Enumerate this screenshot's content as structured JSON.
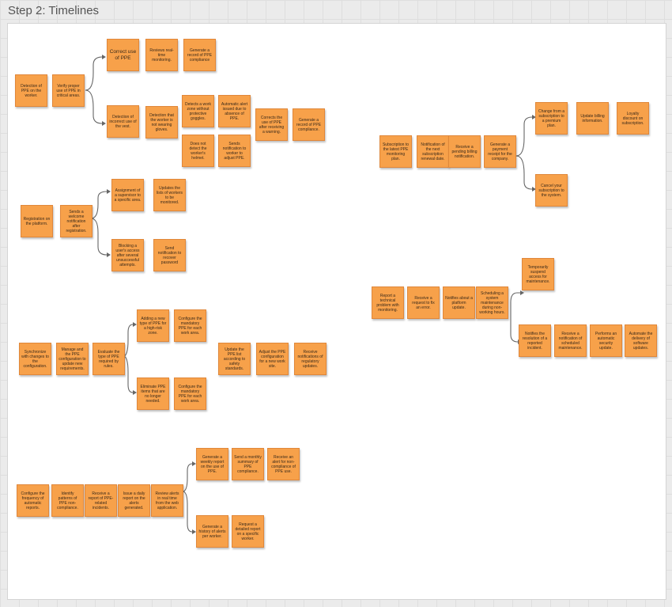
{
  "page": {
    "title": "Step 2: Timelines"
  },
  "notes": [
    "Detection of PPE on the worker.",
    "Verify proper use of PPE in critical areas.",
    "Correct use of PPE",
    "Reviews real-time monitoring.",
    "Generate a record of PPE compliance",
    "Detection of incorrect use of the vest.",
    "Detection that the worker is not wearing gloves.",
    "Detects a work zone without protective goggles.",
    "Automatic alert issued due to absence of PPE.",
    "Does not detect the worker's helmet.",
    "Sends notification to worker to adjust PPE.",
    "Corrects the use of PPE after receiving a warning.",
    "Generate a record of PPE compliance.",
    "Registration on the platform.",
    "Sends a welcome notification after registration.",
    "Assignment of a supervisor to a specific area.",
    "Updates the lists of workers to be monitored.",
    "Blocking a user's access after several unsuccessful attempts.",
    "Send notification to recover password",
    "Synchronize with changes to the configuration.",
    "Manage and the PPE configuration to update new requirements.",
    "Evaluate the type of PPE required by rules.",
    "Adding a new type of PPE for a high-risk zone.",
    "Configure the mandatory PPE for each work area.",
    "Eliminate PPE items that are no longer needed.",
    "Configure the mandatory PPE for each work area.",
    "Update the PPE list according to safety standards.",
    "Adjust the PPE configuration for a new work site.",
    "Receive notifications of regulatory updates.",
    "Configure the frequency of automatic reports.",
    "Identify patterns of PPE non-compliance.",
    "Receive a report of PPE-related incidents.",
    "Issue a daily report on the alerts generated.",
    "Review alerts in real time from the web application.",
    "Generate a weekly report on the use of PPE.",
    "Send a monthly summary of PPE compliance.",
    "Receive an alert for non-compliance of PPE use.",
    "Generate a history of alerts per worker.",
    "Request a detailed report on a specific worker.",
    "Subscription to the latest PPE monitoring plan.",
    "Notification of the next subscription renewal date.",
    "Receive a pending billing notification.",
    "Generate a payment receipt for the company.",
    "Change from a subscription to a premium plan.",
    "Update billing information.",
    "Loyalty discount on subscription.",
    "Cancel your subscription to the system.",
    "Report a technical problem with monitoring.",
    "Receive a request to fix an error.",
    "Notifies about a platform update.",
    "Scheduling a system maintenance during non-working hours.",
    "Temporarily suspend access for maintenance.",
    "Notifies the resolution of a reported incident.",
    "Receive a notification of scheduled maintenance.",
    "Performs an automatic security update.",
    "Automate the delivery of software updates."
  ]
}
